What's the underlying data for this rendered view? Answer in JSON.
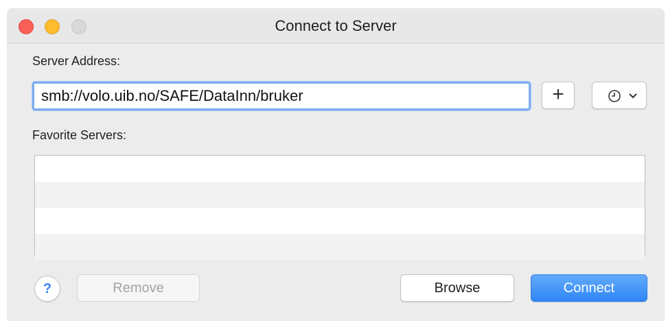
{
  "window": {
    "title": "Connect to Server"
  },
  "server_address": {
    "label": "Server Address:",
    "value": "smb://volo.uib.no/SAFE/DataInn/bruker"
  },
  "add_button": {
    "glyph": "+"
  },
  "favorites": {
    "label": "Favorite Servers:",
    "items": []
  },
  "footer": {
    "help_glyph": "?",
    "remove_label": "Remove",
    "browse_label": "Browse",
    "connect_label": "Connect"
  },
  "icons": {
    "add": "plus-icon",
    "recent": "clock-icon",
    "dropdown": "chevron-down-icon",
    "help": "question-mark-icon"
  },
  "colors": {
    "accent": "#2f86f6",
    "focus_ring": "#7eadf1",
    "close": "#fc5f57",
    "minimize": "#fdbc2e",
    "zoom_disabled": "#d8d8d8"
  }
}
